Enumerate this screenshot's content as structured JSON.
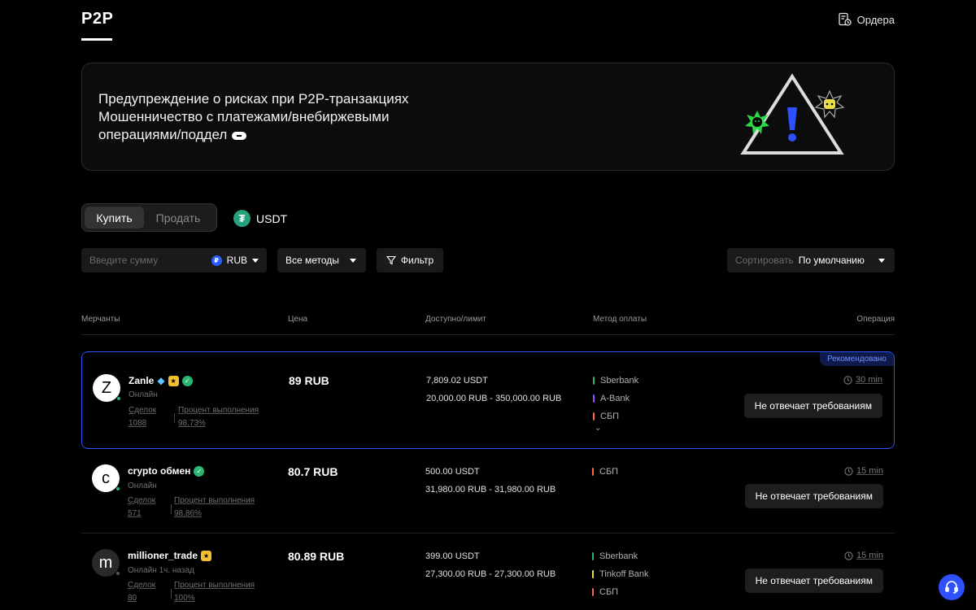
{
  "header": {
    "title": "P2P",
    "orders_label": "Ордера"
  },
  "banner": {
    "line1": "Предупреждение о рисках при P2P-транзакциях",
    "line2": "Мошенничество с платежами/внебиржевыми",
    "line3": "операциями/поддел"
  },
  "trade": {
    "buy_label": "Купить",
    "sell_label": "Продать",
    "coin": "USDT"
  },
  "filters": {
    "amount_placeholder": "Введите сумму",
    "currency": "RUB",
    "methods_label": "Все методы",
    "filter_label": "Фильтр",
    "sort_label": "Сортировать",
    "sort_value": "По умолчанию"
  },
  "table": {
    "headers": {
      "merchants": "Мерчанты",
      "price": "Цена",
      "available": "Доступно/лимит",
      "payment": "Метод оплаты",
      "operation": "Операция"
    },
    "rows": [
      {
        "recommended": "Рекомендовано",
        "avatar": "Z",
        "name": "Zanle",
        "status": "Онлайн",
        "deals_label": "Сделок",
        "deals": "1088",
        "completion_label": "Процент выполнения",
        "completion": "98.73%",
        "price": "89 RUB",
        "available": "7,809.02 USDT",
        "limit": "20,000.00 RUB - 350,000.00 RUB",
        "payments": [
          {
            "name": "Sberbank",
            "color": "#2bb673"
          },
          {
            "name": "A-Bank",
            "color": "#9b4dff"
          },
          {
            "name": "СБП",
            "color": "#ff6a3d"
          }
        ],
        "time": "30 min",
        "action": "Не отвечает требованиям"
      },
      {
        "avatar": "c",
        "name": "crypto обмен",
        "status": "Онлайн",
        "deals_label": "Сделок",
        "deals": "571",
        "completion_label": "Процент выполнения",
        "completion": "98.86%",
        "price": "80.7 RUB",
        "available": "500.00 USDT",
        "limit": "31,980.00 RUB - 31,980.00 RUB",
        "payments": [
          {
            "name": "СБП",
            "color": "#ff6a3d"
          }
        ],
        "time": "15 min",
        "action": "Не отвечает требованиям"
      },
      {
        "avatar": "m",
        "name": "millioner_trade",
        "status": "Онлайн 1ч. назад",
        "deals_label": "Сделок",
        "deals": "80",
        "completion_label": "Процент выполнения",
        "completion": "100%",
        "price": "80.89 RUB",
        "available": "399.00 USDT",
        "limit": "27,300.00 RUB - 27,300.00 RUB",
        "payments": [
          {
            "name": "Sberbank",
            "color": "#2bb673"
          },
          {
            "name": "Tinkoff Bank",
            "color": "#e8e04a"
          },
          {
            "name": "СБП",
            "color": "#ff6a3d"
          }
        ],
        "time": "15 min",
        "action": "Не отвечает требованиям"
      }
    ]
  },
  "colors": {
    "accent": "#2f50ff",
    "online": "#2bb673"
  }
}
